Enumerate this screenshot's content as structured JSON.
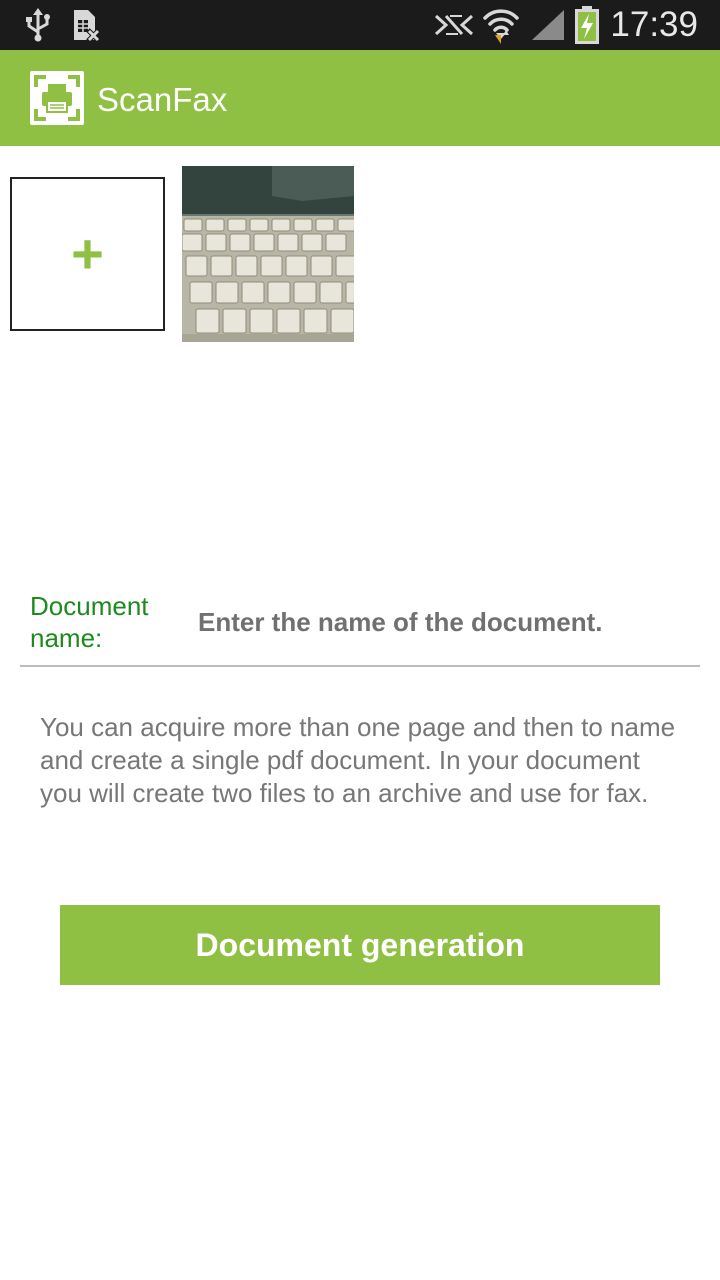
{
  "status_bar": {
    "time": "17:39",
    "icons": [
      "usb-icon",
      "sim-card-error-icon",
      "nfc-muted-icon",
      "wifi-icon",
      "signal-icon",
      "battery-charging-icon"
    ]
  },
  "app_bar": {
    "title": "ScanFax",
    "logo_icon": "scanner-printer-icon"
  },
  "pages": {
    "add_label": "+",
    "thumbnails": [
      {
        "description_icon": "scanned-page-thumbnail"
      }
    ]
  },
  "document": {
    "label": "Document name:",
    "input_value": "",
    "input_placeholder": "Enter the name of the document."
  },
  "info_text": "You can acquire more than one page and then to name and create a single pdf document. In your document you will create two files to an archive and use for fax.",
  "actions": {
    "generate_label": "Document generation"
  },
  "colors": {
    "accent": "#8fc043",
    "label_green": "#1e8a1e",
    "status_bar": "#1b1b1b"
  }
}
